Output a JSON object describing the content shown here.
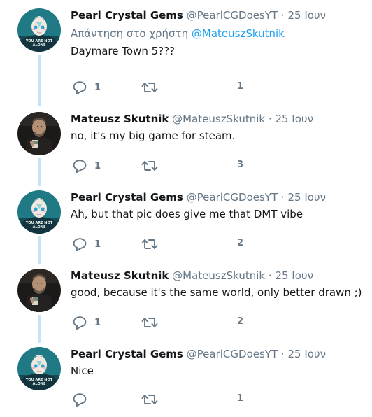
{
  "colors": {
    "link": "#1da1f2",
    "secondary": "#657786",
    "primary_text": "#14171a",
    "thread_line": "#c4e3f8"
  },
  "tweets": [
    {
      "name": "Pearl Crystal Gems",
      "handle": "@PearlCGDoesYT",
      "dot": "·",
      "time": "25 Ιουν",
      "reply_prefix": "Απάντηση στο χρήστη",
      "reply_mention": "@MateuszSkutnik",
      "text": "Daymare Town 5???",
      "reply_count": "1",
      "retweet_count": "",
      "like_count": "1",
      "avatar": "pearl-avatar",
      "avatar_caption": "YOU ARE NOT ALONE"
    },
    {
      "name": "Mateusz Skutnik",
      "handle": "@MateuszSkutnik",
      "dot": "·",
      "time": "25 Ιουν",
      "text": "no, it's my big game for steam.",
      "reply_count": "1",
      "retweet_count": "",
      "like_count": "3",
      "avatar": "mateusz-avatar"
    },
    {
      "name": "Pearl Crystal Gems",
      "handle": "@PearlCGDoesYT",
      "dot": "·",
      "time": "25 Ιουν",
      "text": "Ah, but that pic does give me that DMT vibe",
      "reply_count": "1",
      "retweet_count": "",
      "like_count": "2",
      "avatar": "pearl-avatar",
      "avatar_caption": "YOU ARE NOT ALONE"
    },
    {
      "name": "Mateusz Skutnik",
      "handle": "@MateuszSkutnik",
      "dot": "·",
      "time": "25 Ιουν",
      "text": "good, because it's the same world, only better drawn ;)",
      "reply_count": "1",
      "retweet_count": "",
      "like_count": "2",
      "avatar": "mateusz-avatar"
    },
    {
      "name": "Pearl Crystal Gems",
      "handle": "@PearlCGDoesYT",
      "dot": "·",
      "time": "25 Ιουν",
      "text": "Nice",
      "reply_count": "",
      "retweet_count": "",
      "like_count": "1",
      "avatar": "pearl-avatar",
      "avatar_caption": "YOU ARE NOT ALONE"
    }
  ],
  "icons": {
    "reply": "reply-icon",
    "retweet": "retweet-icon"
  }
}
